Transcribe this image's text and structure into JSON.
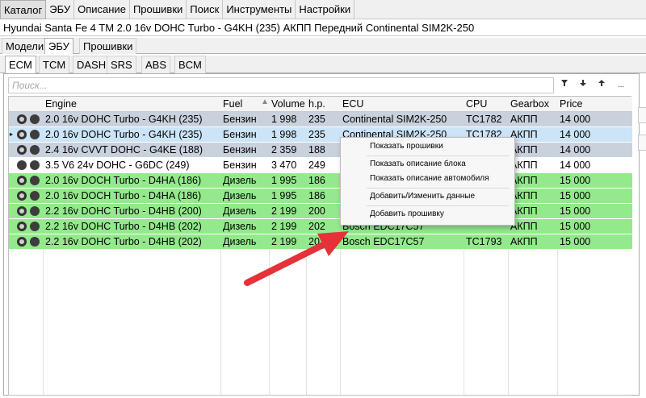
{
  "menubar": {
    "items": [
      "Каталог",
      "ЭБУ",
      "Описание",
      "Прошивки",
      "Поиск",
      "Инструменты",
      "Настройки"
    ]
  },
  "vehicle_title": "Hyundai Santa Fe 4 TM 2.0 16v DOHC Turbo - G4KH (235) АКПП Передний Continental SIM2K-250",
  "tabs_level1": [
    "Модели",
    "ЭБУ",
    "Прошивки"
  ],
  "tabs_level2": [
    "ECM",
    "TCM",
    "DASH",
    "SRS",
    "ABS",
    "BCM"
  ],
  "search": {
    "placeholder": "Поиск..."
  },
  "toolbar": {
    "filter_icon": "filter-icon",
    "down_icon": "arrow-down-icon",
    "up_icon": "arrow-up-icon",
    "more_label": "..."
  },
  "table": {
    "columns": [
      "Engine",
      "Fuel",
      "Volume",
      "h.p.",
      "ECU",
      "CPU",
      "Gearbox",
      "Price"
    ],
    "rows": [
      {
        "engine": "2.0 16v DOHC Turbo - G4KH (235)",
        "fuel": "Бензин",
        "volume": "1 998",
        "hp": "235",
        "ecu": "Continental SIM2K-250",
        "cpu": "TC1782",
        "gearbox": "АКПП",
        "price": "14 000"
      },
      {
        "engine": "2.0 16v DOHC Turbo - G4KH (235)",
        "fuel": "Бензин",
        "volume": "1 998",
        "hp": "235",
        "ecu": "Continental SIM2K-250",
        "cpu": "TC1782",
        "gearbox": "АКПП",
        "price": "14 000"
      },
      {
        "engine": "2.4 16v CVVT DOHC - G4KE (188)",
        "fuel": "Бензин",
        "volume": "2 359",
        "hp": "188",
        "ecu": "C",
        "cpu": "",
        "gearbox": "АКПП",
        "price": "14 000"
      },
      {
        "engine": "3.5 V6 24v DOHC - G6DC (249)",
        "fuel": "Бензин",
        "volume": "3 470",
        "hp": "249",
        "ecu": "C",
        "cpu": "",
        "gearbox": "АКПП",
        "price": "14 000"
      },
      {
        "engine": "2.0 16v DOCH Turbo - D4HA (186)",
        "fuel": "Дизель",
        "volume": "1 995",
        "hp": "186",
        "ecu": "Bo",
        "cpu": "",
        "gearbox": "АКПП",
        "price": "15 000"
      },
      {
        "engine": "2.0 16v DOCH Turbo - D4HA (186)",
        "fuel": "Дизель",
        "volume": "1 995",
        "hp": "186",
        "ecu": "Bo",
        "cpu": "",
        "gearbox": "АКПП",
        "price": "15 000"
      },
      {
        "engine": "2.2 16v DOHC Turbo - D4HB (200)",
        "fuel": "Дизель",
        "volume": "2 199",
        "hp": "200",
        "ecu": "Bo",
        "cpu": "",
        "gearbox": "АКПП",
        "price": "15 000"
      },
      {
        "engine": "2.2 16v DOHC Turbo - D4HB (202)",
        "fuel": "Дизель",
        "volume": "2 199",
        "hp": "202",
        "ecu": "Bosch EDC17C57",
        "cpu": "",
        "gearbox": "АКПП",
        "price": "15 000"
      },
      {
        "engine": "2.2 16v DOHC Turbo - D4HB (202)",
        "fuel": "Дизель",
        "volume": "2 199",
        "hp": "202",
        "ecu": "Bosch EDC17C57",
        "cpu": "TC1793",
        "gearbox": "АКПП",
        "price": "15 000"
      }
    ]
  },
  "context_menu": {
    "items": [
      "Показать прошивки",
      "Показать описание блока",
      "Показать описание автомобиля",
      "Добавить/Изменить данные",
      "Добавить прошивку"
    ]
  },
  "colors": {
    "row_gray": "#c9d1dc",
    "row_selected": "#cce4f7",
    "row_white": "#ffffff",
    "row_green": "#93e98c",
    "arrow_red": "#e5323a"
  }
}
